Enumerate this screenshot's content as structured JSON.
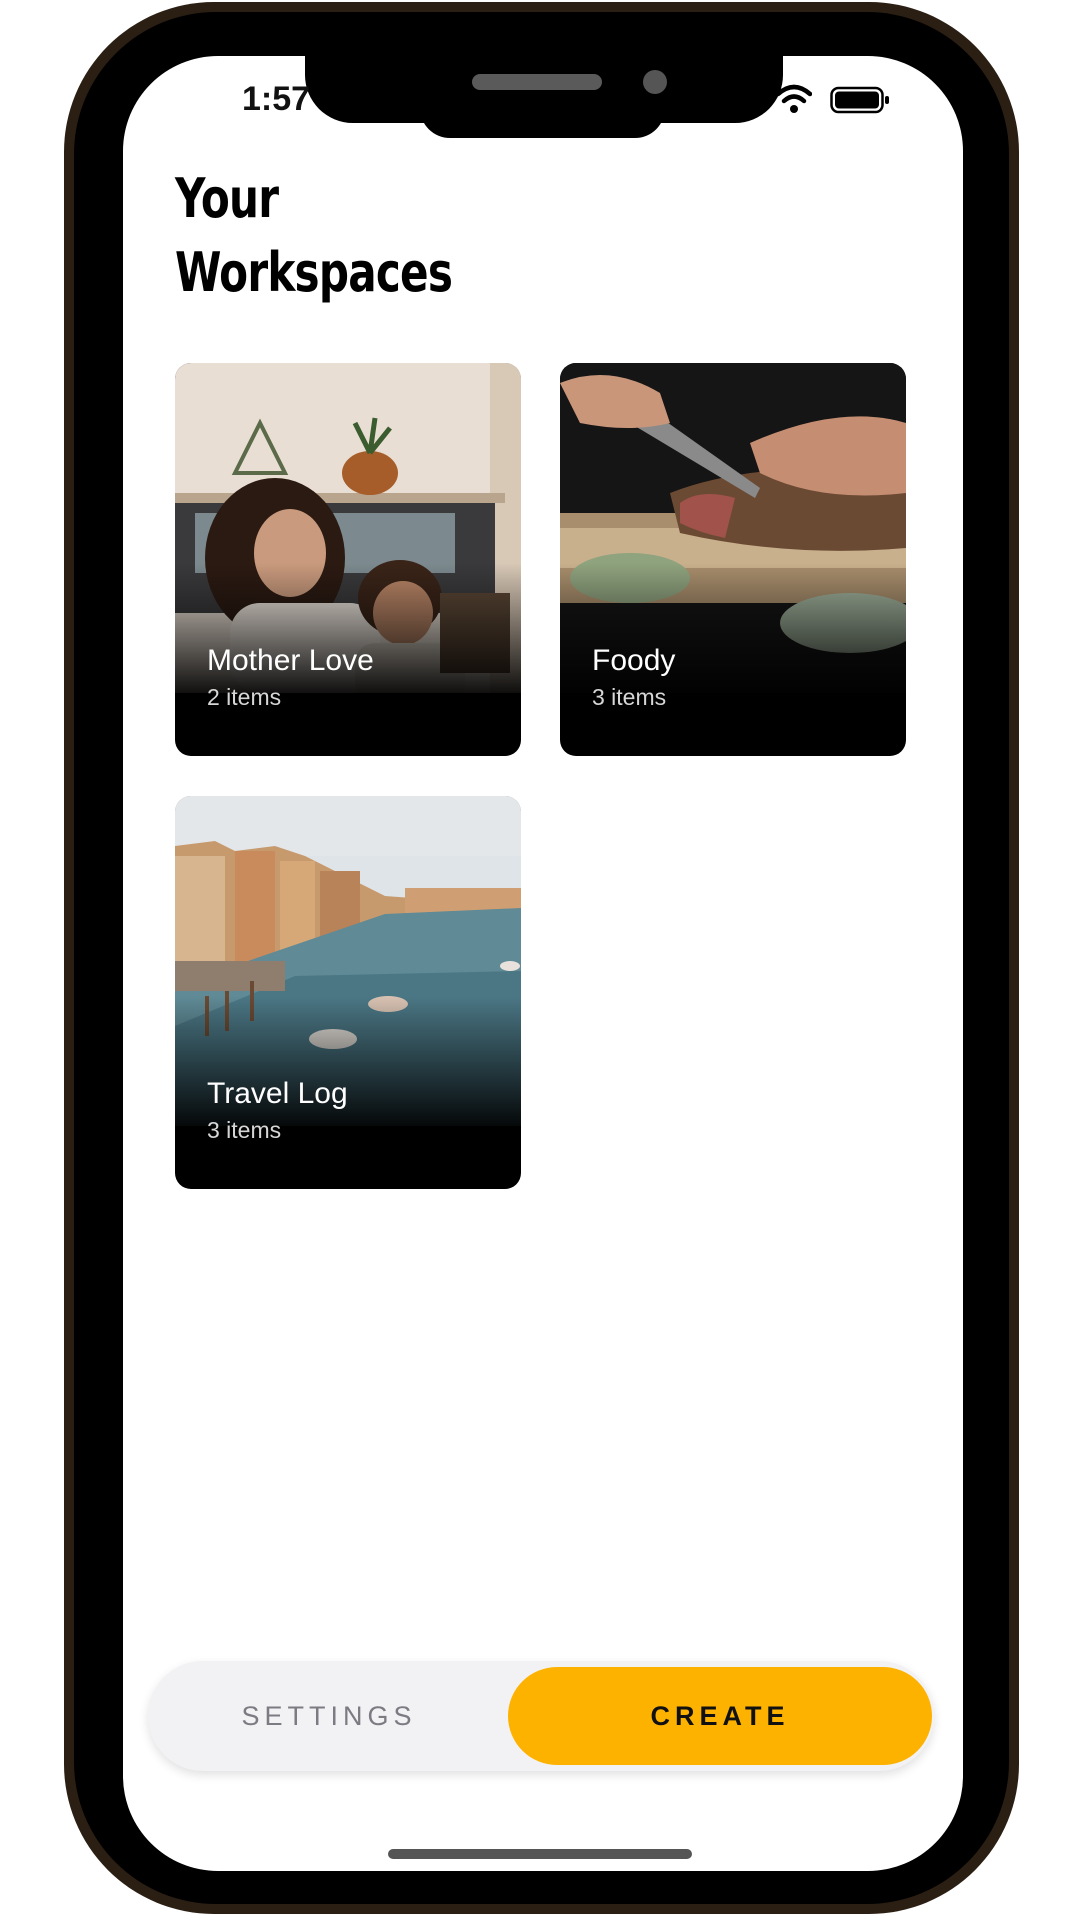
{
  "status_bar": {
    "time": "1:57"
  },
  "header": {
    "title": "Your\nWorkspaces"
  },
  "workspaces": [
    {
      "title": "Mother Love",
      "count": "2 items",
      "image": "mother-child-photo"
    },
    {
      "title": "Foody",
      "count": "3 items",
      "image": "cutting-bread-photo"
    },
    {
      "title": "Travel Log",
      "count": "3 items",
      "image": "venice-canal-photo"
    }
  ],
  "bottom_bar": {
    "settings_label": "SETTINGS",
    "create_label": "CREATE"
  },
  "colors": {
    "accent": "#FDB200",
    "settings_text": "#7B7B82",
    "bar_bg": "#F2F2F4"
  }
}
